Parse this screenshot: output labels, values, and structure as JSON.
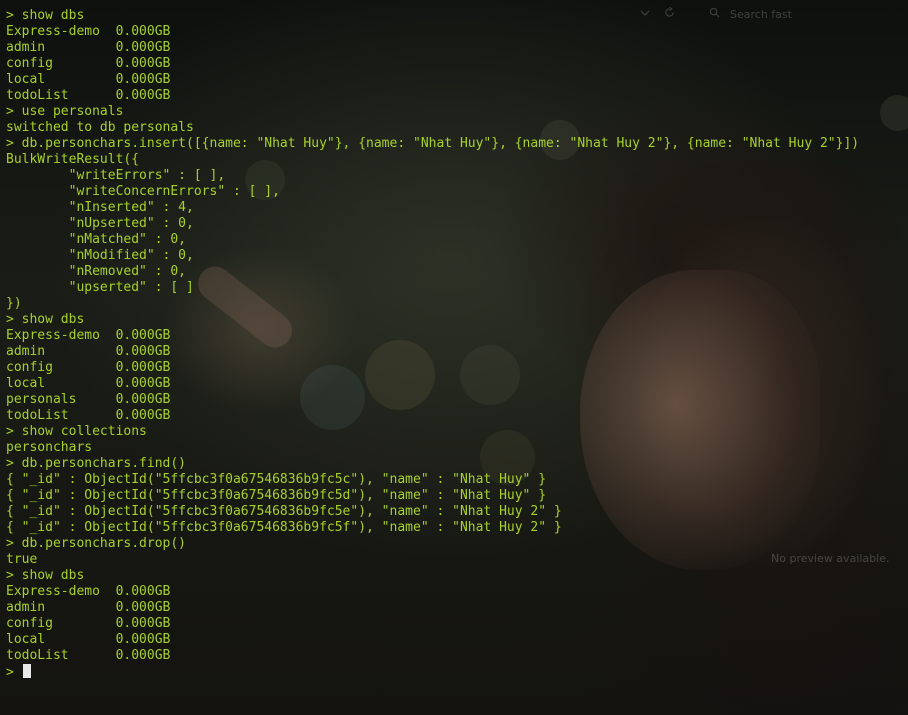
{
  "terminal": {
    "lines": [
      "> show dbs",
      "Express-demo  0.000GB",
      "admin         0.000GB",
      "config        0.000GB",
      "local         0.000GB",
      "todoList      0.000GB",
      "> use personals",
      "switched to db personals",
      "> db.personchars.insert([{name: \"Nhat Huy\"}, {name: \"Nhat Huy\"}, {name: \"Nhat Huy 2\"}, {name: \"Nhat Huy 2\"}])",
      "BulkWriteResult({",
      "        \"writeErrors\" : [ ],",
      "        \"writeConcernErrors\" : [ ],",
      "        \"nInserted\" : 4,",
      "        \"nUpserted\" : 0,",
      "        \"nMatched\" : 0,",
      "        \"nModified\" : 0,",
      "        \"nRemoved\" : 0,",
      "        \"upserted\" : [ ]",
      "})",
      "> show dbs",
      "Express-demo  0.000GB",
      "admin         0.000GB",
      "config        0.000GB",
      "local         0.000GB",
      "personals     0.000GB",
      "todoList      0.000GB",
      "> show collections",
      "personchars",
      "> db.personchars.find()",
      "{ \"_id\" : ObjectId(\"5ffcbc3f0a67546836b9fc5c\"), \"name\" : \"Nhat Huy\" }",
      "{ \"_id\" : ObjectId(\"5ffcbc3f0a67546836b9fc5d\"), \"name\" : \"Nhat Huy\" }",
      "{ \"_id\" : ObjectId(\"5ffcbc3f0a67546836b9fc5e\"), \"name\" : \"Nhat Huy 2\" }",
      "{ \"_id\" : ObjectId(\"5ffcbc3f0a67546836b9fc5f\"), \"name\" : \"Nhat Huy 2\" }",
      "> db.personchars.drop()",
      "true",
      "> show dbs",
      "Express-demo  0.000GB",
      "admin         0.000GB",
      "config        0.000GB",
      "local         0.000GB",
      "todoList      0.000GB"
    ],
    "prompt": "> "
  },
  "overlay": {
    "search_placeholder": "Search fast",
    "no_preview": "No preview available.",
    "icons": [
      "chevron-down-icon",
      "refresh-icon",
      "search-icon"
    ]
  },
  "colors": {
    "text": "#a7d12a",
    "cursor": "#e8e8e8"
  }
}
